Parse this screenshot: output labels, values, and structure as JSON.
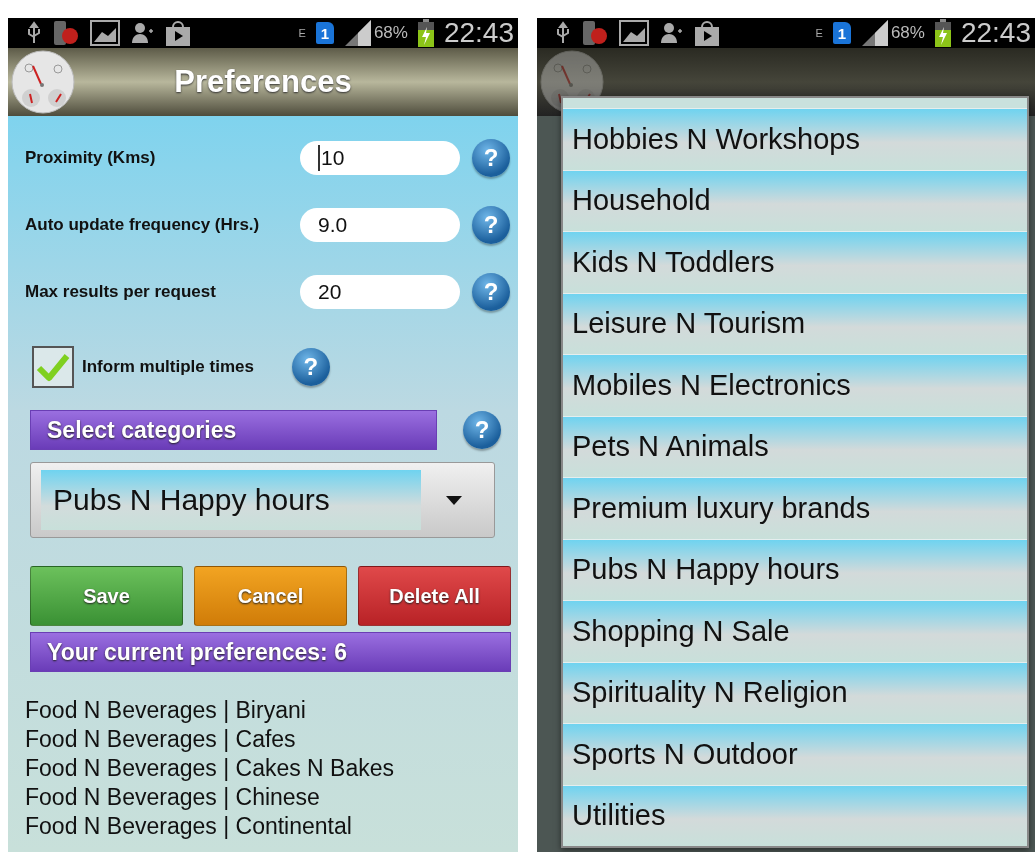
{
  "left_screen": {
    "status_bar": {
      "network": "E",
      "sim": "1",
      "battery": "68%",
      "time": "22:43"
    },
    "title": "Preferences",
    "fields": [
      {
        "label": "Proximity (Kms)",
        "value": "10",
        "focused": true,
        "help": "?"
      },
      {
        "label": "Auto update frequency (Hrs.)",
        "value": "9.0",
        "focused": false,
        "help": "?"
      },
      {
        "label": "Max results per request",
        "value": "20",
        "focused": false,
        "help": "?"
      }
    ],
    "checkbox": {
      "label": "Inform multiple times",
      "checked": true,
      "help": "?"
    },
    "categories_header": {
      "label": "Select categories",
      "help": "?"
    },
    "category_select": {
      "value": "Pubs N Happy hours"
    },
    "buttons": [
      {
        "label": "Save",
        "kind": "save"
      },
      {
        "label": "Cancel",
        "kind": "cancel"
      },
      {
        "label": "Delete All",
        "kind": "delete"
      }
    ],
    "current_header": "Your current preferences: 6",
    "preferences": [
      "Food N Beverages | Biryani",
      "Food N Beverages | Cafes",
      "Food N Beverages | Cakes N Bakes",
      "Food N Beverages | Chinese",
      "Food N Beverages | Continental"
    ]
  },
  "right_screen": {
    "status_bar": {
      "network": "E",
      "sim": "1",
      "battery": "68%",
      "time": "22:43"
    },
    "options": [
      "Hobbies N Workshops",
      "Household",
      "Kids N Toddlers",
      "Leisure N Tourism",
      "Mobiles N Electronics",
      "Pets N Animals",
      "Premium luxury brands",
      "Pubs N Happy hours",
      "Shopping N Sale",
      "Spirituality N Religion",
      "Sports N Outdoor",
      "Utilities"
    ]
  }
}
